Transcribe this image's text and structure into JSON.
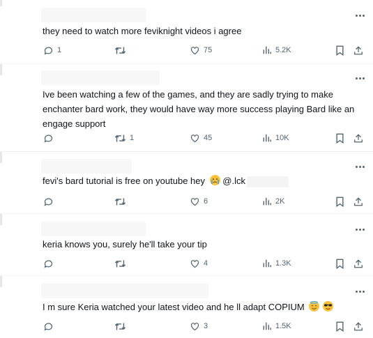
{
  "replies": [
    {
      "text": "they need to watch more feviknight videos i agree",
      "emoji": [],
      "mention": "",
      "stats": {
        "replies": "1",
        "reposts": "",
        "likes": "75",
        "views": "5.2K"
      }
    },
    {
      "text": "Ive been watching a few of the games, and they are sadly trying to make enchanter bard work, they would have way more success playing Bard like an engage support",
      "emoji": [],
      "mention": "",
      "stats": {
        "replies": "",
        "reposts": "1",
        "likes": "45",
        "views": "10K"
      }
    },
    {
      "text": "fevi's bard tutorial is free on youtube hey",
      "emoji": [
        "crying-face"
      ],
      "mention": "@.lck",
      "stats": {
        "replies": "",
        "reposts": "",
        "likes": "6",
        "views": "2K"
      }
    },
    {
      "text": "keria knows you, surely he'll take your tip",
      "emoji": [],
      "mention": "",
      "stats": {
        "replies": "",
        "reposts": "",
        "likes": "4",
        "views": "1.3K"
      }
    },
    {
      "text": "I m sure Keria watched your latest video and he ll adapt COPIUM",
      "emoji": [
        "halo-face",
        "sunglasses-face"
      ],
      "mention": "",
      "stats": {
        "replies": "",
        "reposts": "",
        "likes": "3",
        "views": "1.5K"
      }
    }
  ],
  "colors": {
    "text": "#0f1419",
    "muted": "#536471",
    "divider": "#eff3f4"
  }
}
